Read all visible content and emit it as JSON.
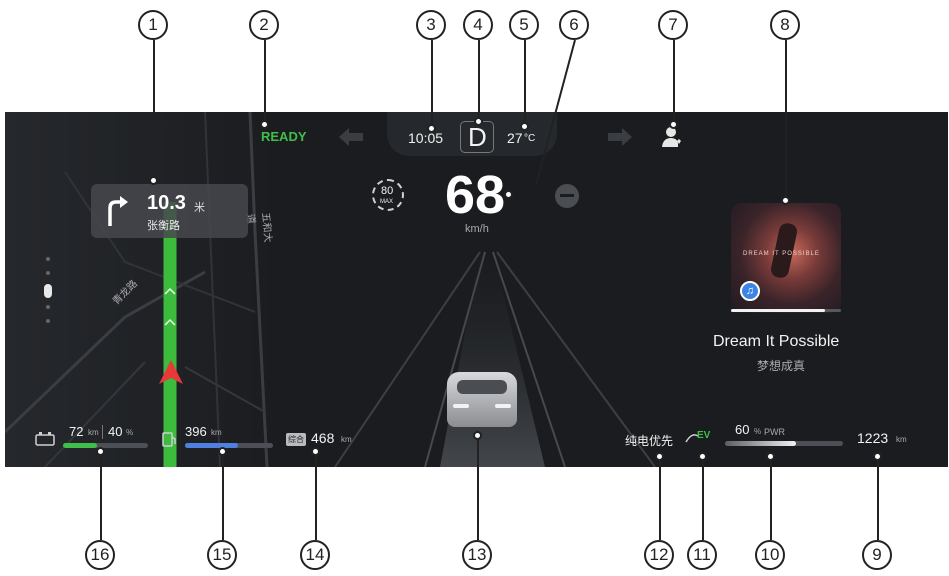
{
  "callouts": [
    "1",
    "2",
    "3",
    "4",
    "5",
    "6",
    "7",
    "8",
    "9",
    "10",
    "11",
    "12",
    "13",
    "14",
    "15",
    "16"
  ],
  "navigation": {
    "distance": "10.3",
    "unit": "米",
    "road": "张衡路",
    "map_labels": [
      "青龙路",
      "五和大道"
    ]
  },
  "status": {
    "ready": "READY"
  },
  "header": {
    "time": "10:05",
    "gear": "D",
    "temp_value": "27",
    "temp_unit": "°C"
  },
  "speed": {
    "value": "68",
    "unit": "km/h",
    "limit": "80",
    "limit_tag": "MAX"
  },
  "media": {
    "title": "Dream It Possible",
    "subtitle": "梦想成真",
    "art_text": "DREAM IT POSSIBLE",
    "progress": 0.85
  },
  "battery": {
    "range": "72",
    "range_unit": "km",
    "percent": "40",
    "percent_unit": "%",
    "level": 0.4
  },
  "fuel": {
    "range": "396",
    "range_unit": "km",
    "level": 0.6
  },
  "combined": {
    "tag": "综合",
    "range": "468",
    "unit": "km"
  },
  "drive_mode": {
    "label": "纯电优先",
    "ev": "EV"
  },
  "power": {
    "value": "60",
    "unit": "%",
    "label": "PWR",
    "level": 0.6
  },
  "odometer": {
    "value": "1223",
    "unit": "km"
  },
  "colors": {
    "panel": "#1a1c1f",
    "ready": "#3fbf4a",
    "route": "#3dbb3d",
    "battery_bar": "#3fbf4a",
    "fuel_bar": "#4f7fe0",
    "ev": "#3fbf4a"
  }
}
